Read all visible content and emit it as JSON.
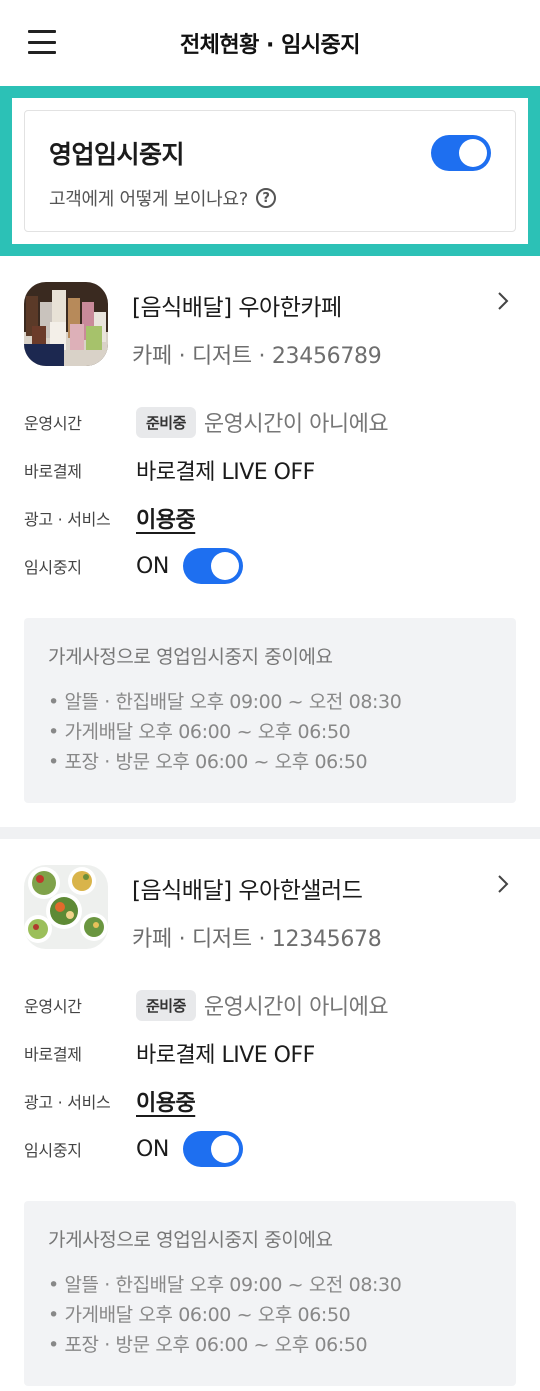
{
  "header": {
    "title": "전체현황 · 임시중지"
  },
  "pause": {
    "title": "영업임시중지",
    "subtitle": "고객에게 어떻게 보이나요?",
    "help_glyph": "?",
    "toggle_on": true
  },
  "labels": {
    "hours": "운영시간",
    "direct_pay": "바로결제",
    "ads": "광고 · 서비스",
    "pause": "임시중지"
  },
  "stores": [
    {
      "name": "[음식배달] 우아한카페",
      "category": "카페 · 디저트  ·  23456789",
      "hours_badge": "준비중",
      "hours_text": "운영시간이 아니에요",
      "direct_pay": "바로결제 LIVE OFF",
      "ads": "이용중",
      "pause_state": "ON",
      "notice_title": "가게사정으로 영업임시중지 중이에요",
      "notice_items": [
        "• 알뜰 · 한집배달  오후 09:00 ~ 오전 08:30",
        "• 가게배달  오후 06:00 ~ 오후 06:50",
        "• 포장 · 방문  오후 06:00 ~ 오후 06:50"
      ]
    },
    {
      "name": "[음식배달] 우아한샐러드",
      "category": "카페 · 디저트  ·  12345678",
      "hours_badge": "준비중",
      "hours_text": "운영시간이 아니에요",
      "direct_pay": "바로결제 LIVE OFF",
      "ads": "이용중",
      "pause_state": "ON",
      "notice_title": "가게사정으로 영업임시중지 중이에요",
      "notice_items": [
        "• 알뜰 · 한집배달  오후 09:00 ~ 오전 08:30",
        "• 가게배달  오후 06:00 ~ 오후 06:50",
        "• 포장 · 방문  오후 06:00 ~ 오후 06:50"
      ]
    }
  ],
  "colors": {
    "accent": "#1e6ff0",
    "highlight": "#2cc1b6"
  },
  "icons": {
    "menu": "hamburger-menu-icon",
    "help": "question-circle-icon",
    "chevron": "chevron-right-icon"
  }
}
